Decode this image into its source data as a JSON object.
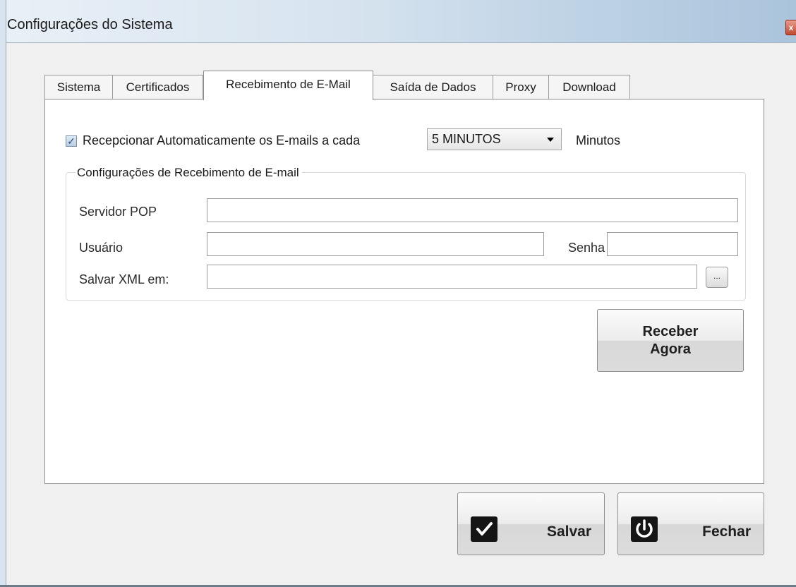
{
  "window": {
    "title": "Configurações do Sistema",
    "close_glyph": "x"
  },
  "tabs": [
    {
      "label": "Sistema",
      "active": false
    },
    {
      "label": "Certificados",
      "active": false
    },
    {
      "label": "Recebimento de E-Mail",
      "active": true
    },
    {
      "label": "Saída de Dados",
      "active": false
    },
    {
      "label": "Proxy",
      "active": false
    },
    {
      "label": "Download",
      "active": false
    }
  ],
  "auto_receive": {
    "checked": true,
    "label": "Recepcionar Automaticamente os E-mails a cada",
    "interval_value": "5 MINUTOS",
    "unit_label": "Minutos"
  },
  "group": {
    "legend": "Configurações de Recebimento de E-mail",
    "pop_label": "Servidor POP",
    "pop_value": "",
    "user_label": "Usuário",
    "user_value": "",
    "password_label": "Senha",
    "password_value": "",
    "xml_label": "Salvar XML em:",
    "xml_value": "",
    "browse_label": "..."
  },
  "receive_button": {
    "line1": "Receber",
    "line2": "Agora"
  },
  "footer": {
    "save_label": "Salvar",
    "close_label": "Fechar"
  },
  "icons": {
    "save": "checkmark-icon",
    "close": "power-icon"
  },
  "colors": {
    "icon_bg": "#151515",
    "panel_bg": "#ffffff",
    "window_bg": "#f0f0f0"
  }
}
